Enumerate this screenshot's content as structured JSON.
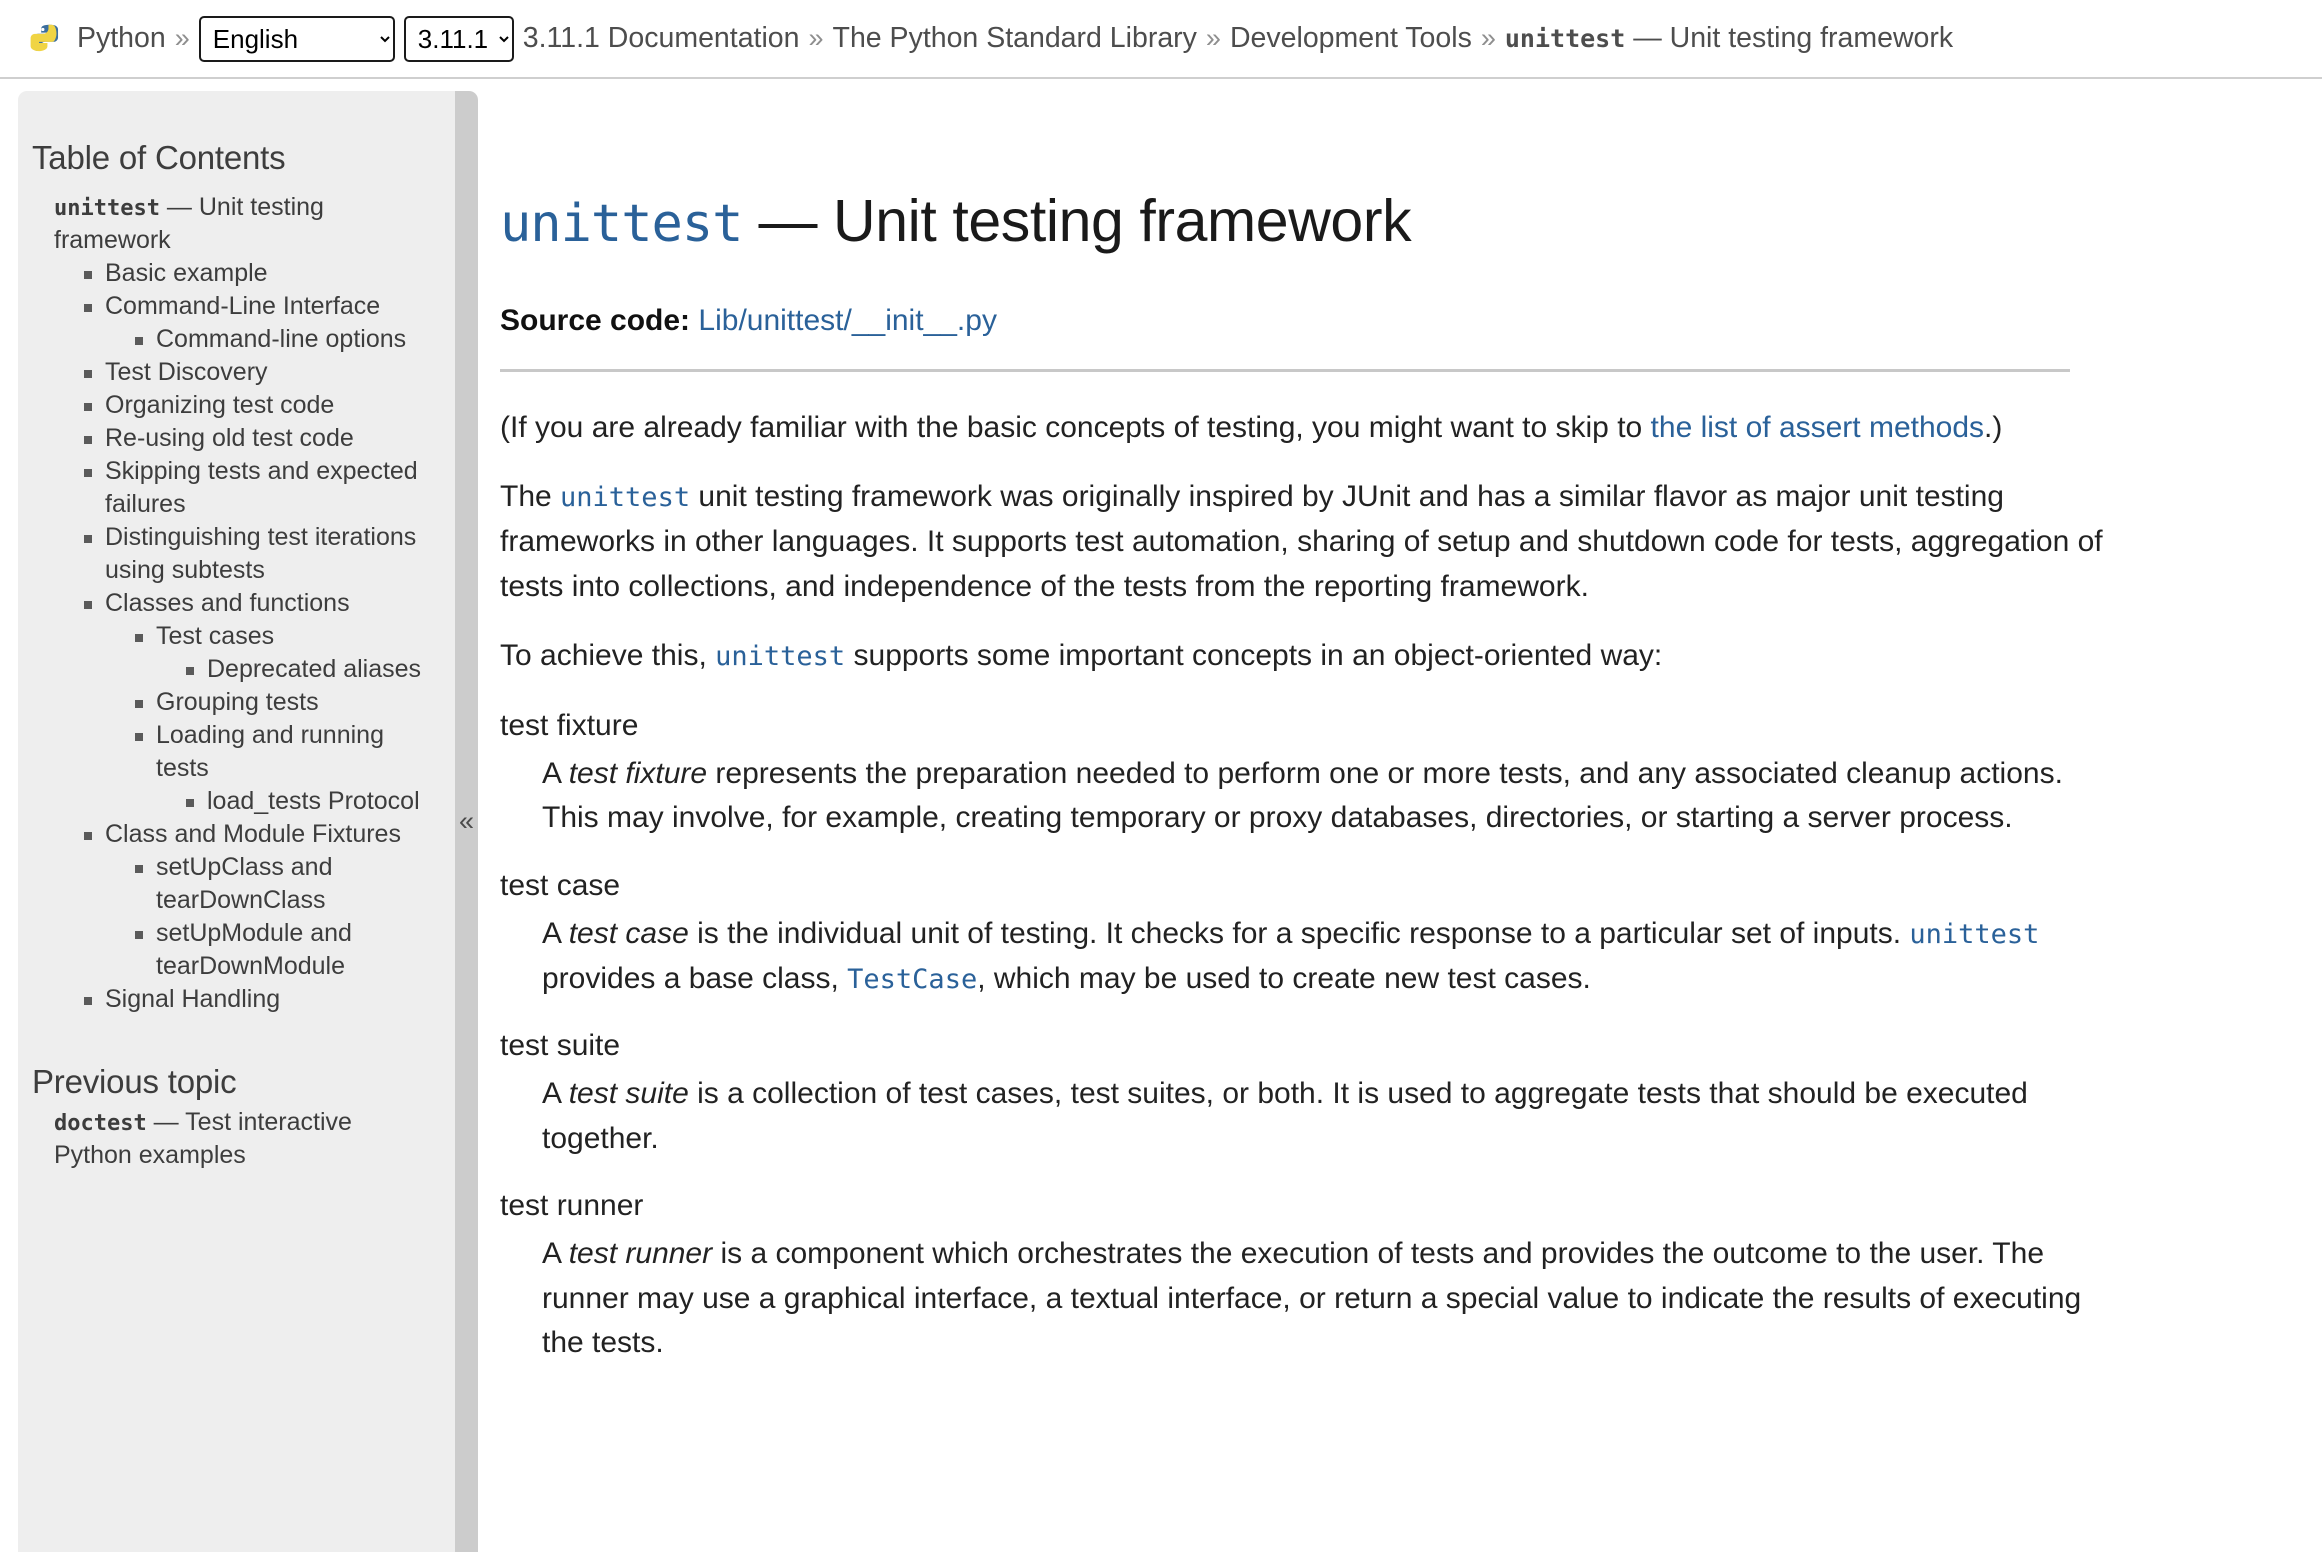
{
  "header": {
    "logo_text": "Python",
    "logo_icon": "python-logo-icon",
    "sep": "»",
    "language_select": {
      "value": "English",
      "options": [
        "English"
      ]
    },
    "version_select": {
      "value": "3.11.1",
      "options": [
        "3.11.1"
      ]
    },
    "breadcrumbs": [
      {
        "label": "3.11.1 Documentation",
        "link": true
      },
      {
        "label": "The Python Standard Library",
        "link": true
      },
      {
        "label": "Development Tools",
        "link": true
      }
    ],
    "current_code": "unittest",
    "current_rest": "— Unit testing framework"
  },
  "sidebar": {
    "toc_heading": "Table of Contents",
    "toc_root_code": "unittest",
    "toc_root_rest": "— Unit testing framework",
    "toc_items": [
      {
        "label": "Basic example",
        "level": 1
      },
      {
        "label": "Command-Line Interface",
        "level": 1
      },
      {
        "label": "Command-line options",
        "level": 2
      },
      {
        "label": "Test Discovery",
        "level": 1
      },
      {
        "label": "Organizing test code",
        "level": 1
      },
      {
        "label": "Re-using old test code",
        "level": 1
      },
      {
        "label": "Skipping tests and expected failures",
        "level": 1
      },
      {
        "label": "Distinguishing test iterations using subtests",
        "level": 1
      },
      {
        "label": "Classes and functions",
        "level": 1
      },
      {
        "label": "Test cases",
        "level": 2
      },
      {
        "label": "Deprecated aliases",
        "level": 3
      },
      {
        "label": "Grouping tests",
        "level": 2
      },
      {
        "label": "Loading and running tests",
        "level": 2
      },
      {
        "label": "load_tests Protocol",
        "level": 3
      },
      {
        "label": "Class and Module Fixtures",
        "level": 1
      },
      {
        "label": "setUpClass and tearDownClass",
        "level": 2
      },
      {
        "label": "setUpModule and tearDownModule",
        "level": 2
      },
      {
        "label": "Signal Handling",
        "level": 1
      }
    ],
    "previous_topic_heading": "Previous topic",
    "previous_topic_code": "doctest",
    "previous_topic_rest": "— Test interactive Python examples",
    "collapse_handle_glyph": "«"
  },
  "main": {
    "title_code": "unittest",
    "title_rest": "— Unit testing framework",
    "source_code_label": "Source code:",
    "source_code_link": "Lib/unittest/__init__.py",
    "intro_paragraph": {
      "before": "(If you are already familiar with the basic concepts of testing, you might want to skip to ",
      "link": "the list of assert methods",
      "after": ".)"
    },
    "paragraph_2": {
      "part1": "The ",
      "code1": "unittest",
      "part2": " unit testing framework was originally inspired by JUnit and has a similar flavor as major unit testing frameworks in other languages. It supports test automation, sharing of setup and shutdown code for tests, aggregation of tests into collections, and independence of the tests from the reporting framework."
    },
    "paragraph_3": {
      "part1": "To achieve this, ",
      "code1": "unittest",
      "part2": " supports some important concepts in an object-oriented way:"
    },
    "glossary": [
      {
        "term": "test fixture",
        "def_a": "A ",
        "def_em": "test fixture",
        "def_b": " represents the preparation needed to perform one or more tests, and any associated cleanup actions. This may involve, for example, creating temporary or proxy databases, directories, or starting a server process."
      },
      {
        "term": "test case",
        "def_a": "A ",
        "def_em": "test case",
        "def_b": " is the individual unit of testing. It checks for a specific response to a particular set of inputs. ",
        "def_code1": "unittest",
        "def_c": " provides a base class, ",
        "def_code2": "TestCase",
        "def_d": ", which may be used to create new test cases."
      },
      {
        "term": "test suite",
        "def_a": "A ",
        "def_em": "test suite",
        "def_b": " is a collection of test cases, test suites, or both. It is used to aggregate tests that should be executed together."
      },
      {
        "term": "test runner",
        "def_a": "A ",
        "def_em": "test runner",
        "def_b": " is a component which orchestrates the execution of tests and provides the outcome to the user. The runner may use a graphical interface, a textual interface, or return a special value to indicate the results of executing the tests."
      }
    ]
  },
  "colors": {
    "link": "#2a6199",
    "sidebar_bg": "#eeeeee",
    "handle_bg": "#cccccc",
    "text": "#222222",
    "muted": "#4d4d4d"
  }
}
